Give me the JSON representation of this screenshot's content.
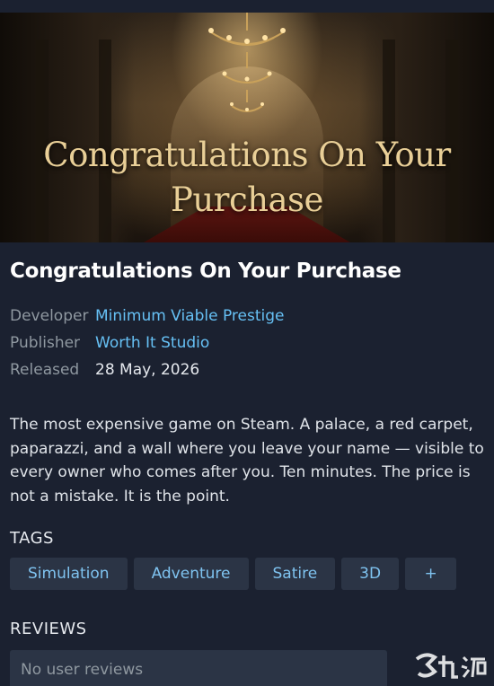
{
  "hero": {
    "title_line1": "Congratulations On Your",
    "title_line2": "Purchase"
  },
  "game": {
    "title": "Congratulations On Your Purchase"
  },
  "meta": {
    "developer_label": "Developer",
    "developer_value": "Minimum Viable Prestige",
    "publisher_label": "Publisher",
    "publisher_value": "Worth It Studio",
    "released_label": "Released",
    "released_value": "28 May, 2026"
  },
  "description": "The most expensive game on Steam. A palace, a red carpet, paparazzi, and a wall where you leave your name — visible to every owner who comes after you. Ten minutes. The price is not a mistake. It is the point.",
  "tags": {
    "heading": "TAGS",
    "items": [
      "Simulation",
      "Adventure",
      "Satire",
      "3D",
      "+"
    ]
  },
  "reviews": {
    "heading": "REVIEWS",
    "empty_text": "No user reviews"
  },
  "watermark": {
    "icon": "site-logo-icon"
  },
  "colors": {
    "background": "#1b2130",
    "link": "#66c0f4",
    "label": "#8f98a0",
    "tag_bg": "#2b3445",
    "hero_text": "#e9cf97"
  }
}
